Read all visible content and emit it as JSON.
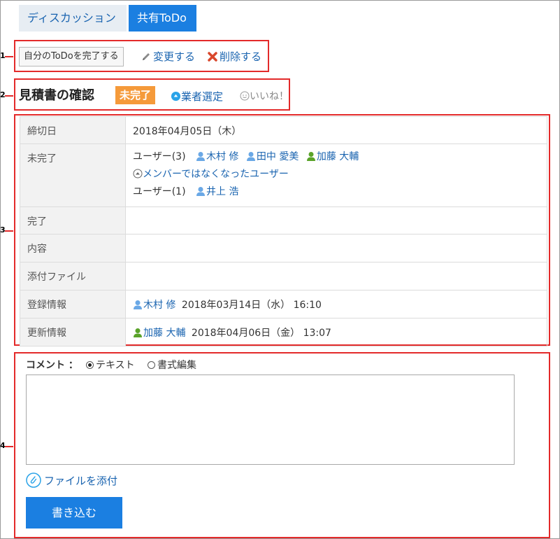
{
  "tabs": [
    {
      "label": "ディスカッション",
      "active": false
    },
    {
      "label": "共有ToDo",
      "active": true
    }
  ],
  "actions": {
    "complete_button": "自分のToDoを完了する",
    "edit_label": "変更する",
    "delete_label": "削除する"
  },
  "todo": {
    "title": "見積書の確認",
    "status_badge": "未完了",
    "category_link": "業者選定",
    "like_label": "いいね！"
  },
  "detail": {
    "deadline": {
      "label": "締切日",
      "value": "2018年04月05日（木）"
    },
    "incomplete": {
      "label": "未完了",
      "users_group_label": "ユーザー(3)",
      "users": [
        "木村 修",
        "田中 愛美",
        "加藤 大輔"
      ],
      "former_members_link": "メンバーではなくなったユーザー",
      "users_group2_label": "ユーザー(1)",
      "users2": [
        "井上 浩"
      ]
    },
    "complete": {
      "label": "完了",
      "value": ""
    },
    "content": {
      "label": "内容",
      "value": ""
    },
    "attachments": {
      "label": "添付ファイル",
      "value": ""
    },
    "registered": {
      "label": "登録情報",
      "user": "木村 修",
      "datetime": "2018年03月14日（水） 16:10"
    },
    "updated": {
      "label": "更新情報",
      "user": "加藤 大輔",
      "datetime": "2018年04月06日（金） 13:07"
    }
  },
  "comment": {
    "label": "コメント ：",
    "mode_text": "テキスト",
    "mode_rich": "書式編集",
    "selected_mode": "テキスト",
    "attach_link": "ファイルを添付",
    "submit_label": "書き込む"
  },
  "callout_numbers": [
    "1",
    "2",
    "3",
    "4"
  ],
  "colors": {
    "accent": "#1b7fe1",
    "link": "#1a64b0",
    "badge": "#f59a3a",
    "callout": "#e32a2a",
    "user_icon_blue": "#6aa8e6",
    "user_icon_green": "#5aa32a"
  }
}
